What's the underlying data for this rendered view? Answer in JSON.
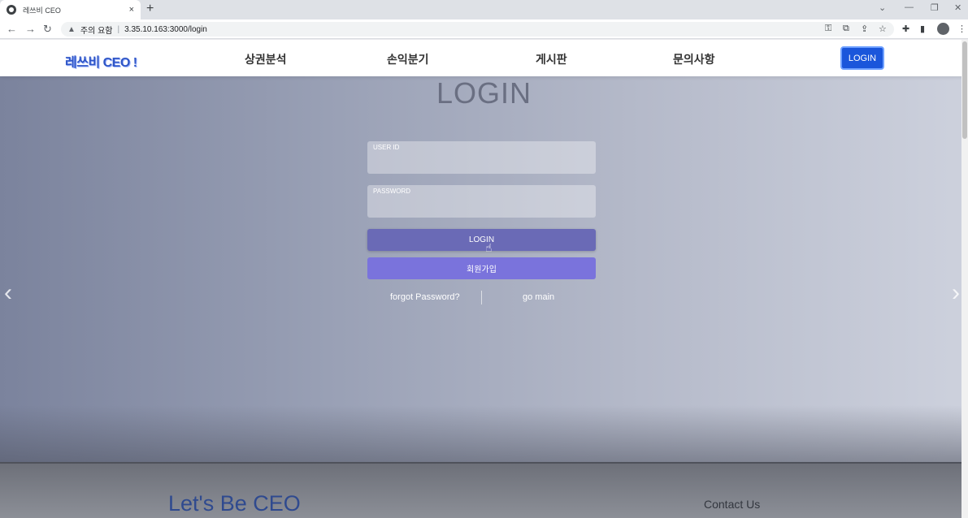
{
  "browser": {
    "tab_title": "레쓰비 CEO",
    "tab_close": "×",
    "new_tab": "+",
    "url_warning": "주의 요함",
    "url": "3.35.10.163:3000/login"
  },
  "header": {
    "logo": "레쓰비 CEO !",
    "nav": [
      "상권분석",
      "손익분기",
      "게시판",
      "문의사항"
    ],
    "login_label": "LOGIN"
  },
  "login": {
    "title": "LOGIN",
    "user_id_label": "USER ID",
    "password_label": "PASSWORD",
    "login_button": "LOGIN",
    "signup_button": "회원가입",
    "forgot_link": "forgot Password?",
    "main_link": "go main"
  },
  "carousel": {
    "prev": "‹",
    "next": "›"
  },
  "footer": {
    "title": "Let's Be CEO",
    "contact": "Contact Us"
  }
}
